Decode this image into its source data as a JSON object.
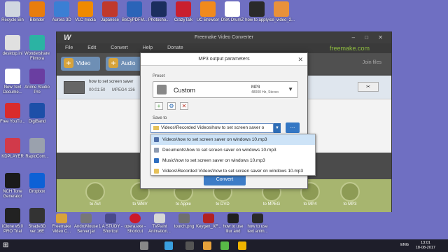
{
  "desktop_icons": [
    {
      "label": "Recycle Bin",
      "color": "#d0d6e0"
    },
    {
      "label": "Blender",
      "color": "#e87d0d"
    },
    {
      "label": "Aurora 3D",
      "color": "#3b7fd4"
    },
    {
      "label": "VLC media",
      "color": "#f08a00"
    },
    {
      "label": "Japanese",
      "color": "#c0392b"
    },
    {
      "label": "BeCyPDFM...",
      "color": "#2b64b8"
    },
    {
      "label": "Photosho...",
      "color": "#1b2d5e"
    },
    {
      "label": "CrazyTalk",
      "color": "#c91f2e"
    },
    {
      "label": "UC Browser",
      "color": "#f18a1c"
    },
    {
      "label": "DSK DrumZ",
      "color": "#ffffff"
    },
    {
      "label": "how to apply",
      "color": "#2a2a2a"
    },
    {
      "label": "ice_video_2...",
      "color": "#e8913a"
    },
    {
      "label": "desktop.ini",
      "color": "#e0e0e0"
    },
    {
      "label": "Wondershare Filmora",
      "color": "#2bb3a3"
    },
    {
      "label": "New Text Docume...",
      "color": "#ffffff"
    },
    {
      "label": "Anime Studio Pro",
      "color": "#6a3ea1"
    },
    {
      "label": "Free YouTu...",
      "color": "#d92b2b"
    },
    {
      "label": "DigiBand",
      "color": "#1d4fa8"
    },
    {
      "label": "KDPLAYER",
      "color": "#d13a4a"
    },
    {
      "label": "RapidCom...",
      "color": "#9aa1ad"
    },
    {
      "label": "NCH Tone Generator",
      "color": "#1a1a1a"
    },
    {
      "label": "Dropbox",
      "color": "#0d61d6"
    },
    {
      "label": "iClone v6.0 PRO Trial",
      "color": "#222222"
    },
    {
      "label": "Shade3D ver.16E",
      "color": "#333333"
    },
    {
      "label": "Freemake Video C...",
      "color": "#d8a33a"
    },
    {
      "label": "AndroMouse Server.jar",
      "color": "#777777"
    },
    {
      "label": "1 A STUDY - Shortcut",
      "color": "#4a4a8a"
    },
    {
      "label": "opera.exe - Shortcut",
      "color": "#cc1a2a"
    },
    {
      "label": "TVPaint Animation...",
      "color": "#d6d6d6"
    },
    {
      "label": "tourch.png",
      "color": "#6f6f6f"
    },
    {
      "label": "Keygen_XF...",
      "color": "#b22222"
    },
    {
      "label": "how to use lilur and",
      "color": "#1f1f1f"
    },
    {
      "label": "how to use text anim...",
      "color": "#2a2a2a"
    }
  ],
  "window": {
    "title": "Freemake Video Converter",
    "logo": "W",
    "controls": "–  □  ✕",
    "menu": [
      "File",
      "Edit",
      "Convert",
      "Help",
      "Donate"
    ],
    "brand": "freemake.com",
    "toolbar": {
      "video_label": "Video",
      "audio_label": "Audio",
      "join_label": "Join files"
    },
    "file": {
      "name": "how to set screen saver",
      "duration": "00:01:50",
      "codec": "MPEG4  136",
      "edit_label": "✂"
    },
    "formats": [
      "to AVI",
      "to WMV",
      "to Apple",
      "to DVD",
      "to MPEG",
      "to MP4",
      "to MP3"
    ]
  },
  "dialog": {
    "title": "MP3 output parameters",
    "close": "✕",
    "preset_label": "Preset",
    "preset_name": "Custom",
    "preset_format": "MP3",
    "preset_detail": "48000 Hz, Stereo",
    "save_label": "Save to",
    "save_path": "Videos\\Recorded Videos\\how to set screen saver o",
    "browse_label": "...",
    "convert_label": "Convert",
    "dropdown_items": [
      {
        "text": "Videos\\how to set screen saver on windows 10.mp3",
        "color": "#4d6ea8"
      },
      {
        "text": "Documents\\how to set screen saver on windows 10.mp3",
        "color": "#8e9bb0"
      },
      {
        "text": "Music\\how to set screen saver on windows 10.mp3",
        "color": "#2f6fc0"
      },
      {
        "text": "Videos\\Recorded Videos\\how to set screen saver on windows 10.mp3",
        "color": "#e6c15a"
      }
    ]
  },
  "taskbar": {
    "start": "⊞",
    "tray_text": "ENG",
    "time": "13:01",
    "date": "18-08-2017"
  }
}
